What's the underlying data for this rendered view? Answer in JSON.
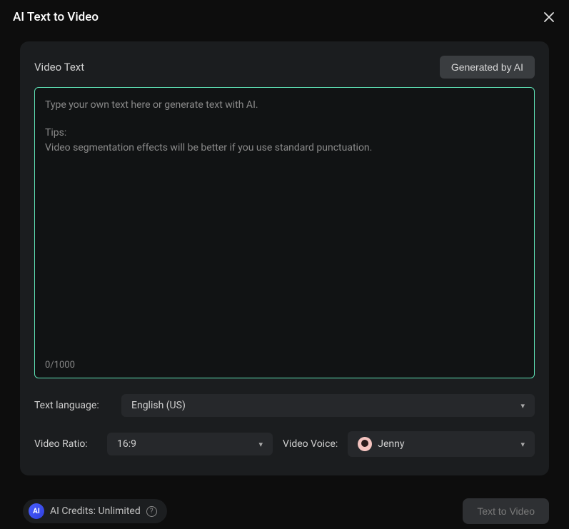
{
  "header": {
    "title": "AI Text to Video"
  },
  "panel": {
    "video_text_label": "Video Text",
    "generated_btn": "Generated by AI",
    "placeholder_line1": "Type your own text here or generate text with AI.",
    "placeholder_line2": "Tips:",
    "placeholder_line3": "Video segmentation effects will be better if you use standard punctuation.",
    "char_count": "0/1000",
    "language_label": "Text language:",
    "language_value": "English (US)",
    "ratio_label": "Video Ratio:",
    "ratio_value": "16:9",
    "voice_label": "Video Voice:",
    "voice_value": "Jenny"
  },
  "footer": {
    "ai_badge": "AI",
    "credits_text": "AI Credits: Unlimited",
    "submit_btn": "Text to Video"
  }
}
